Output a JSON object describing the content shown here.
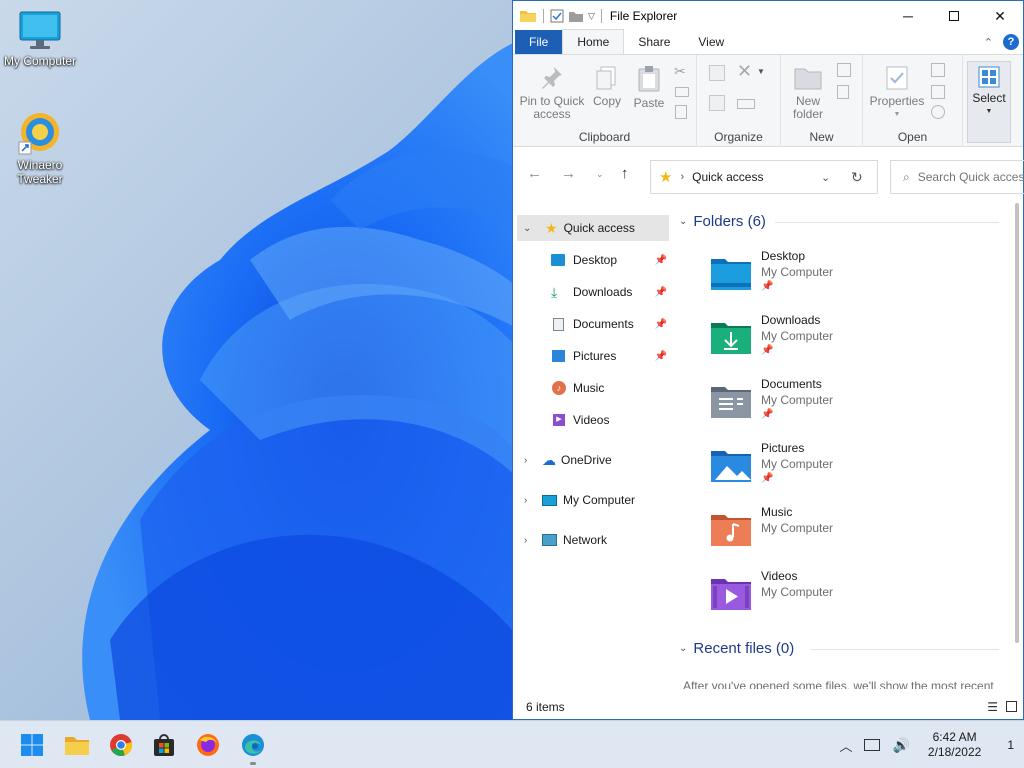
{
  "desktop": {
    "icons": [
      {
        "label": "My Computer"
      },
      {
        "label": "Winaero Tweaker"
      }
    ]
  },
  "window": {
    "title": "File Explorer",
    "tabs": [
      "File",
      "Home",
      "Share",
      "View"
    ],
    "ribbon": {
      "clipboard": {
        "label": "Clipboard",
        "pin": "Pin to Quick access",
        "copy": "Copy",
        "paste": "Paste"
      },
      "organize": {
        "label": "Organize"
      },
      "new": {
        "label": "New",
        "new_folder": "New folder"
      },
      "open": {
        "label": "Open",
        "properties": "Properties"
      },
      "select": {
        "label": "Select"
      }
    },
    "address": {
      "crumb": "Quick access"
    },
    "search": {
      "placeholder": "Search Quick access"
    },
    "nav": {
      "quick_access": "Quick access",
      "pinned": [
        "Desktop",
        "Downloads",
        "Documents",
        "Pictures"
      ],
      "unpinned": [
        "Music",
        "Videos"
      ],
      "onedrive": "OneDrive",
      "mycomputer": "My Computer",
      "network": "Network"
    },
    "content": {
      "folders_header": "Folders (6)",
      "folders": [
        {
          "name": "Desktop",
          "location": "My Computer",
          "color": "#1b8fd6"
        },
        {
          "name": "Downloads",
          "location": "My Computer",
          "color": "#1a9c6e"
        },
        {
          "name": "Documents",
          "location": "My Computer",
          "color": "#7b8796"
        },
        {
          "name": "Pictures",
          "location": "My Computer",
          "color": "#2a86d8"
        },
        {
          "name": "Music",
          "location": "My Computer",
          "color": "#e2704a"
        },
        {
          "name": "Videos",
          "location": "My Computer",
          "color": "#8a4fd0"
        }
      ],
      "recent_header": "Recent files (0)",
      "recent_message": "After you've opened some files, we'll show the most recent"
    },
    "status": {
      "count": "6 items"
    }
  },
  "taskbar": {
    "time": "6:42 AM",
    "date": "2/18/2022",
    "notifications": "1"
  },
  "colors": {
    "accent": "#1c5fb4",
    "header_blue": "#1e3a8a"
  }
}
